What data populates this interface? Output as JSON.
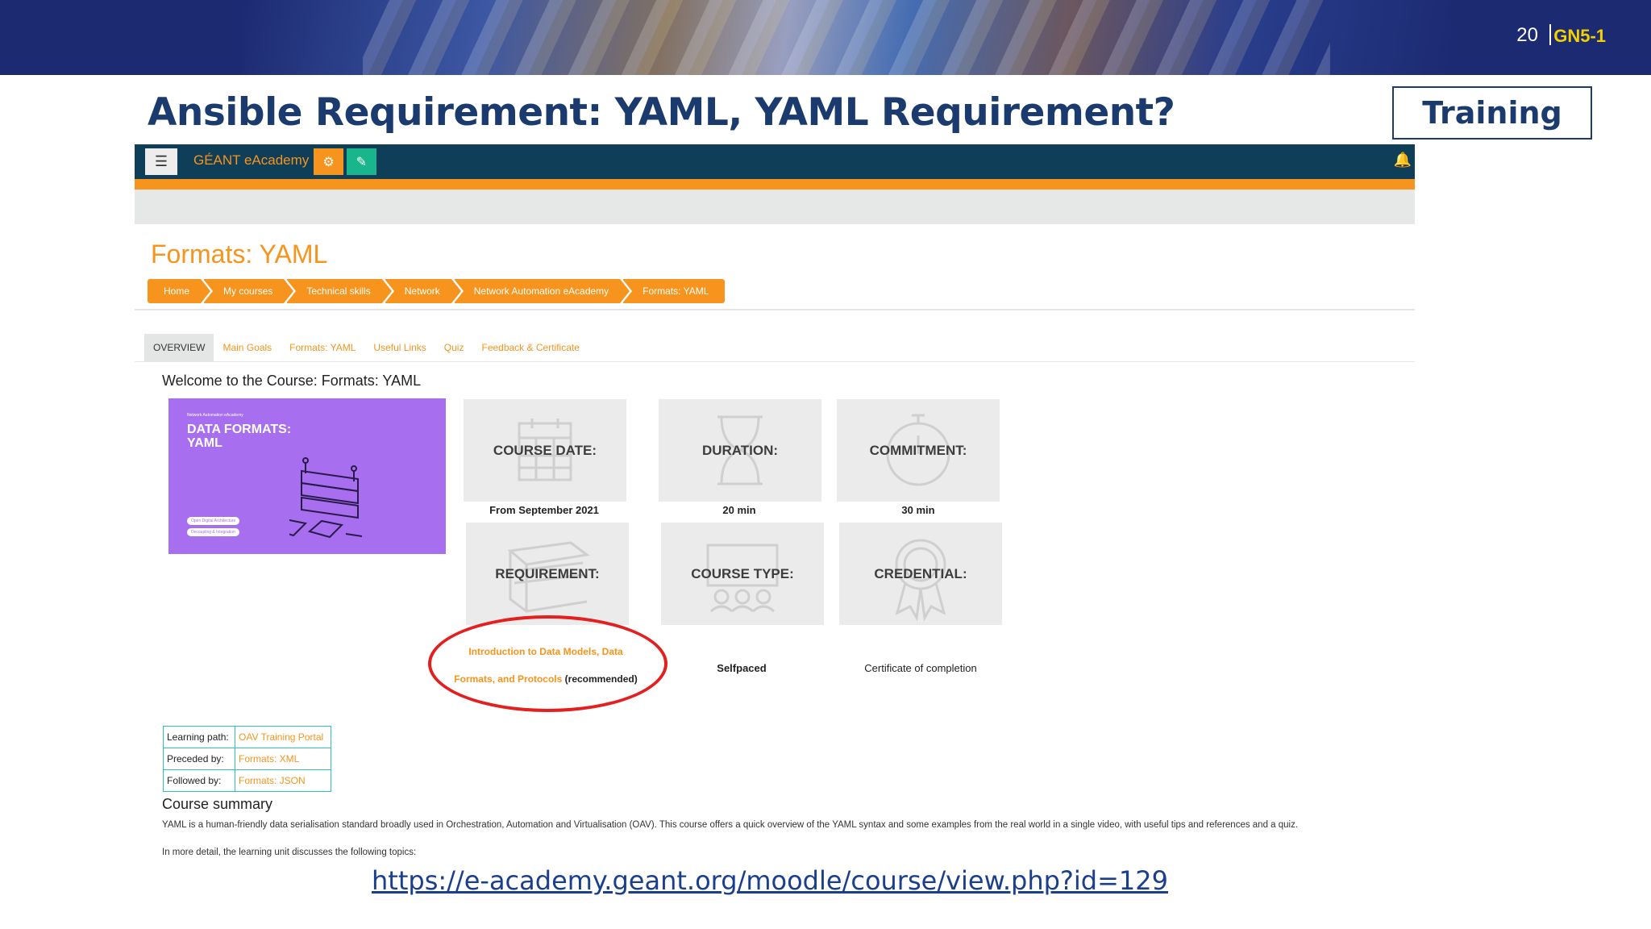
{
  "slide": {
    "page_number": "20",
    "code": "GN5-1",
    "title": "Ansible Requirement: YAML, YAML Requirement?",
    "tag": "Training",
    "url": "https://e-academy.geant.org/moodle/course/view.php?id=129"
  },
  "navbar": {
    "menu_icon": "☰",
    "brand": "GÉANT eAcademy",
    "btn1_icon": "⚙",
    "btn2_icon": "✎",
    "bell_icon": "🔔"
  },
  "course": {
    "title": "Formats: YAML",
    "breadcrumb": [
      "Home",
      "My courses",
      "Technical skills",
      "Network",
      "Network Automation eAcademy",
      "Formats: YAML"
    ],
    "tabs": [
      "OVERVIEW",
      "Main Goals",
      "Formats: YAML",
      "Useful Links",
      "Quiz",
      "Feedback & Certificate"
    ],
    "welcome": "Welcome to the Course: Formats: YAML",
    "image": {
      "small_label": "Network Automation eAcademy",
      "title_line1": "DATA FORMATS:",
      "title_line2": "YAML",
      "pill1": "Open Digital Architecture",
      "pill2": "Decoupling & Integration"
    },
    "cards": {
      "course_date": {
        "label": "COURSE DATE:",
        "value": "From September 2021"
      },
      "duration": {
        "label": "DURATION:",
        "value": "20 min"
      },
      "commitment": {
        "label": "COMMITMENT:",
        "value": "30 min"
      },
      "requirement": {
        "label": "REQUIREMENT:",
        "link_line1": "Introduction to Data Models, Data",
        "link_line2": "Formats, and Protocols",
        "suffix": "(recommended)"
      },
      "course_type": {
        "label": "COURSE TYPE:",
        "value": "Selfpaced"
      },
      "credential": {
        "label": "CREDENTIAL:",
        "value": "Certificate of completion"
      }
    },
    "info_table": [
      {
        "key": "Learning path:",
        "value": "OAV Training Portal"
      },
      {
        "key": "Preceded by:",
        "value": "Formats: XML"
      },
      {
        "key": "Followed by:",
        "value": "Formats: JSON"
      }
    ],
    "summary_heading": "Course summary",
    "summary_text": "YAML is a human-friendly data serialisation standard broadly used in Orchestration, Automation and Virtualisation (OAV). This course offers a quick overview of the YAML syntax and some examples from the real world in a single video, with useful tips and references and a quiz.",
    "summary_more": "In more detail, the learning unit discusses the following topics:"
  },
  "colors": {
    "navy": "#1b3a6d",
    "orange": "#f7941d",
    "teal": "#0e3e58",
    "highlight_red": "#e3201f",
    "purple": "#a86ef0"
  }
}
